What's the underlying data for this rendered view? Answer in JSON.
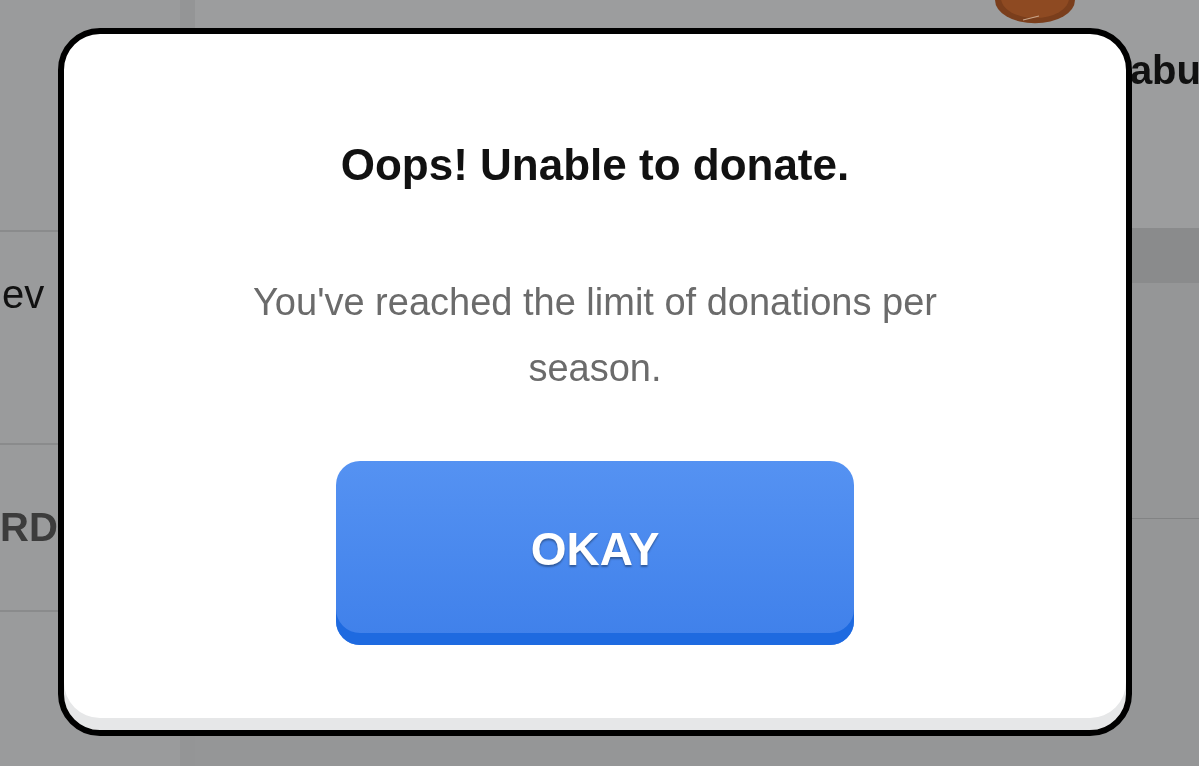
{
  "background": {
    "texts": [
      "abu",
      "ev",
      "RD"
    ]
  },
  "dialog": {
    "title": "Oops! Unable to donate.",
    "message": "You've reached the limit of donations per season.",
    "button": "OKAY"
  }
}
